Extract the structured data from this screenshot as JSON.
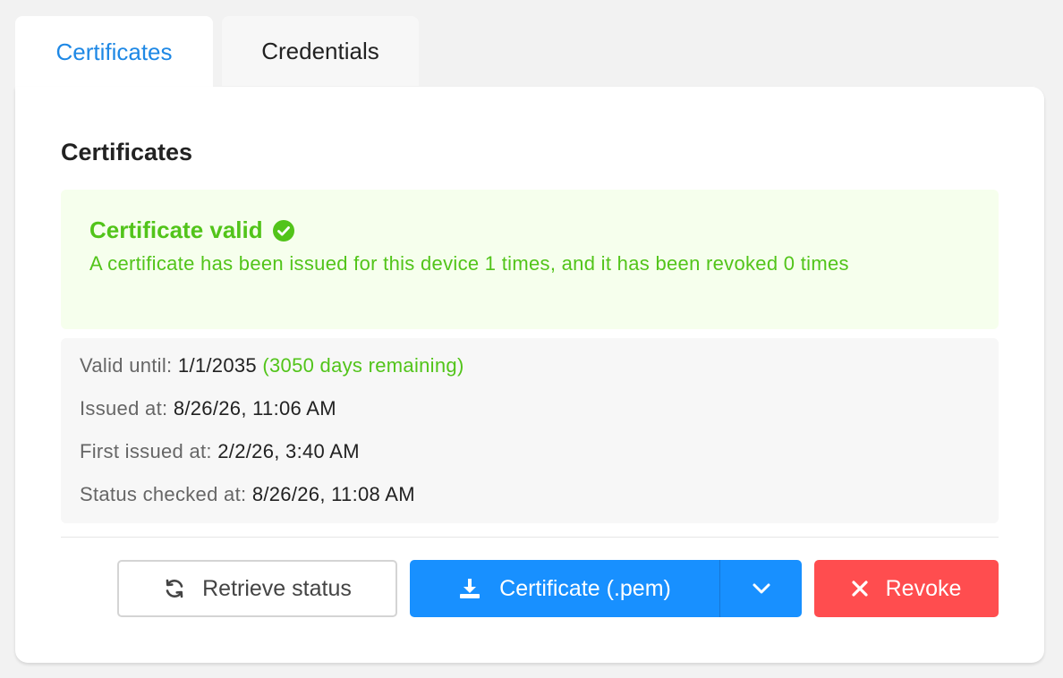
{
  "tabs": [
    {
      "label": "Certificates",
      "active": true
    },
    {
      "label": "Credentials",
      "active": false
    }
  ],
  "section": {
    "title": "Certificates"
  },
  "alert": {
    "title": "Certificate valid",
    "icon": "check-circle-icon",
    "text": "A certificate has been issued for this device 1 times, and it has been revoked 0 times",
    "color": "#52c41a",
    "background": "#f6ffed"
  },
  "info": {
    "valid_until_label": "Valid until:",
    "valid_until_value": "1/1/2035",
    "remaining": "(3050 days remaining)",
    "issued_at_label": "Issued at:",
    "issued_at_value": "8/26/26, 11:06 AM",
    "first_issued_label": "First issued at:",
    "first_issued_value": "2/2/26, 3:40 AM",
    "status_checked_label": "Status checked at:",
    "status_checked_value": "8/26/26, 11:08 AM"
  },
  "actions": {
    "retrieve_label": "Retrieve status",
    "retrieve_icon": "sync-icon",
    "certificate_label": "Certificate (.pem)",
    "certificate_icon": "download-icon",
    "dropdown_icon": "chevron-down-icon",
    "revoke_label": "Revoke",
    "revoke_icon": "close-icon"
  },
  "colors": {
    "accent": "#1890ff",
    "tab_active": "#1e88e5",
    "danger": "#ff4d4f",
    "success": "#52c41a"
  }
}
